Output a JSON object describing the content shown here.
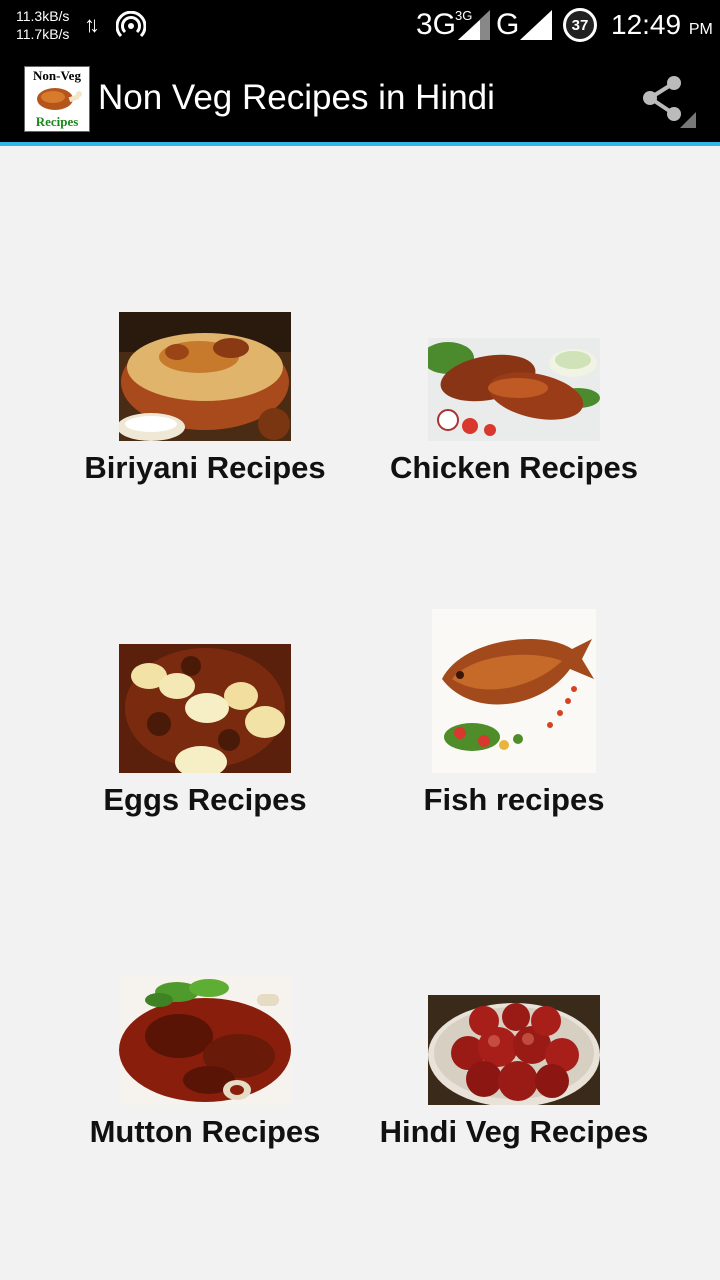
{
  "status_bar": {
    "upload_speed": "11.3kB/s",
    "download_speed": "11.7kB/s",
    "network_primary": "3G",
    "network_secondary": "3G",
    "network_tertiary": "G",
    "battery": "37",
    "time": "12:49",
    "ampm": "PM"
  },
  "action_bar": {
    "logo_top": "Non-Veg",
    "logo_bottom": "Recipes",
    "title": "Non Veg Recipes in Hindi",
    "share_icon": "share-icon"
  },
  "categories": [
    {
      "label": "Biriyani Recipes",
      "image": "biriyani-image"
    },
    {
      "label": "Chicken Recipes",
      "image": "chicken-image"
    },
    {
      "label": "Eggs Recipes",
      "image": "eggs-image"
    },
    {
      "label": "Fish recipes",
      "image": "fish-image"
    },
    {
      "label": "Mutton Recipes",
      "image": "mutton-image"
    },
    {
      "label": "Hindi Veg Recipes",
      "image": "veg-image"
    }
  ],
  "colors": {
    "accent": "#33b5e5",
    "bar": "#000000",
    "background": "#f2f2f2"
  }
}
